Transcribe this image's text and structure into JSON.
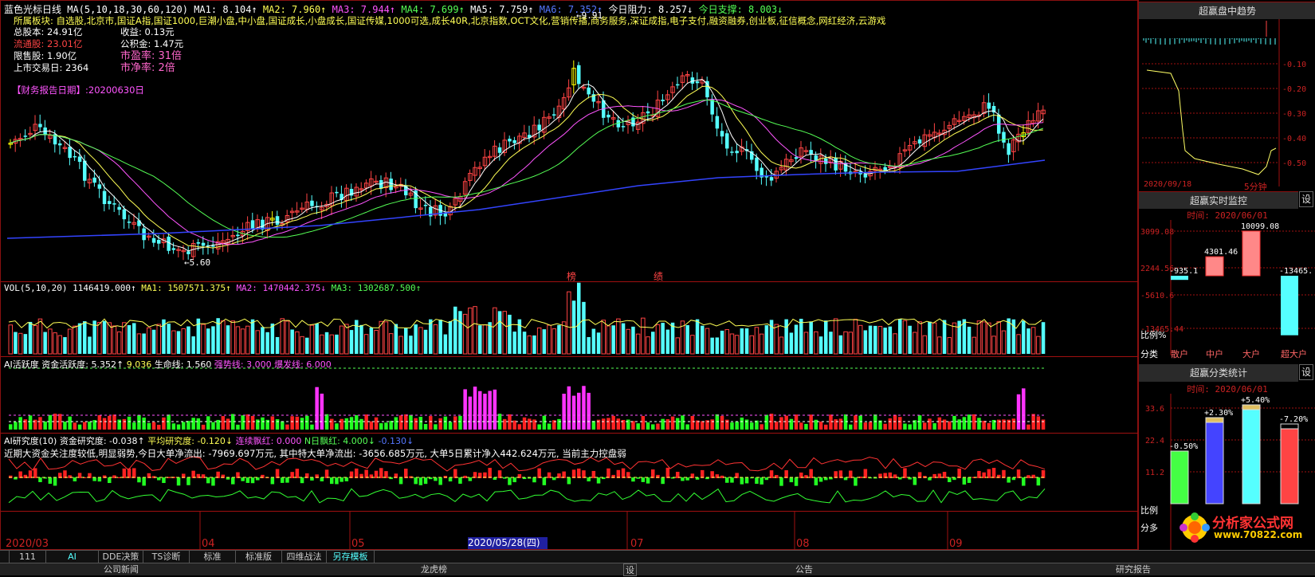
{
  "header": {
    "title": "蓝色光标日线",
    "ma_params": "MA(5,10,18,30,60,120)",
    "ma1": "MA1: 8.104↑",
    "ma2": "MA2: 7.960↑",
    "ma3": "MA3: 7.944↑",
    "ma4": "MA4: 7.699↑",
    "ma5": "MA5: 7.759↑",
    "ma6": "MA6: 7.352↑",
    "resist": "今日阻力: 8.257↓",
    "support": "今日支撑: 8.003↓"
  },
  "sector": "所属板块: 自选股,北京市,国证A指,国证1000,巨潮小盘,中小盘,国证成长,小盘成长,国证传媒,1000可选,成长40R,北京指数,OCT文化,营销传播,商务服务,深证成指,电子支付,融资融券,创业板,征信概念,网红经济,云游戏",
  "info": {
    "l1": "总股本: 24.91亿",
    "l2": "流通股: 23.01亿",
    "l3": "限售股: 1.90亿",
    "l4": "上市交易日: 2364",
    "r1": "收益: 0.13元",
    "r2": "公积金: 1.47元",
    "pe": "市盈率: 31倍",
    "pb": "市净率: 2倍",
    "report": "【财务报告日期】:20200630日"
  },
  "chart_labels": {
    "low": "←5.60",
    "high": "←9.91",
    "bang": "榜",
    "ji": "绩"
  },
  "vol": {
    "label": "VOL(5,10,20)",
    "v": "1146419.000↑",
    "ma1": "MA1: 1507571.375↑",
    "ma2": "MA2: 1470442.375↓",
    "ma3": "MA3: 1302687.500↑"
  },
  "ai": {
    "label": "AI活跃度",
    "fund": "资金活跃度: 5.352↑",
    "v2": "9.036",
    "life": "生命线: 1.560",
    "strong": "强势线: 3.000",
    "burst": "爆发线: 6.000"
  },
  "research": {
    "label": "AI研究度(10)",
    "fund": "资金研究度: -0.038↑",
    "avg": "平均研究度: -0.120↓",
    "cont": "连续飘红: 0.000",
    "n": "N日飘红: 4.000↓",
    "last": "-0.130↓",
    "comment": "近期大资金关注度较低,明显弱势,今日大单净流出: -7969.697万元, 其中特大单净流出: -3656.685万元, 大单5日累计净入442.624万元, 当前主力控盘弱"
  },
  "xaxis": {
    "m1": "2020/03",
    "m2": "04",
    "m3": "05",
    "date": "2020/05/28(四)",
    "m4": "07",
    "m5": "08",
    "m6": "09"
  },
  "tabs": [
    "",
    "111",
    "AI",
    "DDE决策",
    "TS诊断",
    "标准",
    "标准版",
    "四维战法",
    "另存模板"
  ],
  "bottom": {
    "b1": "公司新闻",
    "b2": "龙虎榜",
    "b3": "设",
    "b4": "公告",
    "b5": "研究报告"
  },
  "right": {
    "trend_title": "超赢盘中趋势",
    "trend_y": [
      "-0.10",
      "-0.20",
      "-0.30",
      "-0.40",
      "-0.50"
    ],
    "trend_date": "2020/09/18",
    "trend_period": "5分钟",
    "mon_title": "超赢实时监控",
    "mon_time": "时间: 2020/06/01",
    "mon_y": [
      "3099.08",
      "2244.56",
      "-5610.6",
      "-13465.44"
    ],
    "mon_vals": [
      "-935.1",
      "4301.46",
      "10099.08",
      "-13465."
    ],
    "mon_ratio": "比例%",
    "mon_cats": [
      "分类",
      "散户",
      "中户",
      "大户",
      "超大户"
    ],
    "cls_title": "超赢分类统计",
    "cls_time": "时间: 2020/06/01",
    "cls_y": [
      "33.6",
      "22.4",
      "11.2"
    ],
    "cls_vals": [
      "-0.50%",
      "+2.30%",
      "+5.40%",
      "-7.20%"
    ],
    "cls_ratio": "比例",
    "set": "设",
    "fen": "分多"
  },
  "watermark": {
    "name": "分析家公式网",
    "url": "www.70822.com"
  }
}
